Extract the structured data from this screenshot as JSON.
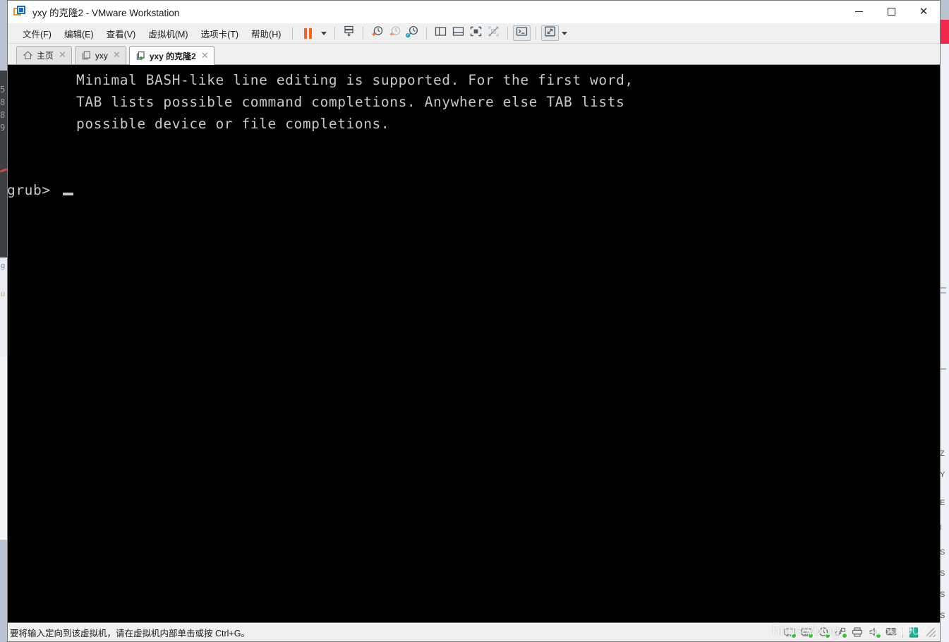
{
  "window": {
    "title": "yxy 的克隆2 - VMware Workstation",
    "app_icon": "vmware-logo-icon",
    "controls": {
      "minimize": "minimize-icon",
      "maximize": "maximize-icon",
      "close": "close-icon"
    }
  },
  "menubar": {
    "items": [
      {
        "label": "文件(F)",
        "name": "menu-file"
      },
      {
        "label": "编辑(E)",
        "name": "menu-edit"
      },
      {
        "label": "查看(V)",
        "name": "menu-view"
      },
      {
        "label": "虚拟机(M)",
        "name": "menu-vm"
      },
      {
        "label": "选项卡(T)",
        "name": "menu-tabs"
      },
      {
        "label": "帮助(H)",
        "name": "menu-help"
      }
    ]
  },
  "toolbar": {
    "buttons": [
      {
        "name": "pause-button",
        "icon": "pause-icon",
        "tooltip": "暂停"
      },
      {
        "name": "power-dropdown",
        "icon": "chevron-down-icon",
        "tooltip": "电源"
      },
      {
        "name": "manage-snapshot-button",
        "icon": "snapshot-manage-icon",
        "tooltip": "管理快照"
      },
      {
        "name": "take-snapshot-button",
        "icon": "snapshot-add-icon",
        "tooltip": "拍摄快照"
      },
      {
        "name": "revert-snapshot-button",
        "icon": "snapshot-revert-icon",
        "tooltip": "恢复快照"
      },
      {
        "name": "snapshot-manager-button",
        "icon": "snapshot-settings-icon",
        "tooltip": "快照管理器"
      },
      {
        "name": "show-library-button",
        "icon": "panel-left-icon",
        "tooltip": "显示或隐藏虚拟机库"
      },
      {
        "name": "show-thumbnail-button",
        "icon": "panel-bottom-icon",
        "tooltip": "显示或隐藏缩略图栏"
      },
      {
        "name": "fullscreen-button",
        "icon": "fullscreen-icon",
        "tooltip": "进入全屏模式"
      },
      {
        "name": "unity-button",
        "icon": "unity-mode-icon",
        "tooltip": "Unity 模式"
      },
      {
        "name": "console-view-button",
        "icon": "console-icon",
        "tooltip": "控制台视图",
        "pressed": true
      },
      {
        "name": "stretch-guest-button",
        "icon": "expand-arrows-icon",
        "tooltip": "自由拉伸客户机",
        "pressed": true
      },
      {
        "name": "stretch-dropdown",
        "icon": "chevron-down-icon",
        "tooltip": "更多"
      }
    ]
  },
  "tabs": [
    {
      "label": "主页",
      "icon": "home-icon",
      "active": false,
      "name": "tab-home",
      "closable": true
    },
    {
      "label": "yxy",
      "icon": "vm-icon",
      "active": false,
      "name": "tab-yxy",
      "closable": true
    },
    {
      "label": "yxy 的克隆2",
      "icon": "vm-running-icon",
      "active": true,
      "name": "tab-yxy-clone2",
      "closable": true
    }
  ],
  "vm_console": {
    "lines": [
      "Minimal BASH-like line editing is supported. For the first word,",
      "TAB lists possible command completions. Anywhere else TAB lists",
      "possible device or file completions."
    ],
    "prompt": "grub>",
    "cursor": "_",
    "background_color": "#000000",
    "text_color": "#c8c8c8"
  },
  "statusbar": {
    "message": "要将输入定向到该虚拟机，请在虚拟机内部单击或按 Ctrl+G。",
    "devices": [
      {
        "name": "hard-disk-icon",
        "connected": true
      },
      {
        "name": "cd-dvd-icon",
        "connected": true
      },
      {
        "name": "network-adapter-icon",
        "connected": true
      },
      {
        "name": "usb-controller-icon",
        "connected": true
      },
      {
        "name": "printer-icon",
        "connected": false
      },
      {
        "name": "sound-card-icon",
        "connected": true
      },
      {
        "name": "display-icon",
        "connected": false
      },
      {
        "name": "message-log-icon",
        "connected": false
      }
    ],
    "resize_grip": "resize-grip-icon"
  },
  "watermark": {
    "text": "https://blog",
    "number": "48609902"
  },
  "background_windows": {
    "left_gutter_lines": [
      "5",
      "8",
      "8",
      "9"
    ],
    "left_code_fragment": "g",
    "left_small_text_1": "g",
    "left_small_text_2": "u",
    "right_fragments": [
      "Z",
      "Y",
      "E",
      "I",
      "S",
      "S",
      "S",
      "S"
    ]
  },
  "colors": {
    "accent_orange": "#f26522",
    "accent_blue": "#1a6fc4",
    "console_bg": "#000000",
    "console_fg": "#c8c8c8",
    "chrome_bg": "#f0f0f0",
    "status_green": "#35c43a"
  }
}
